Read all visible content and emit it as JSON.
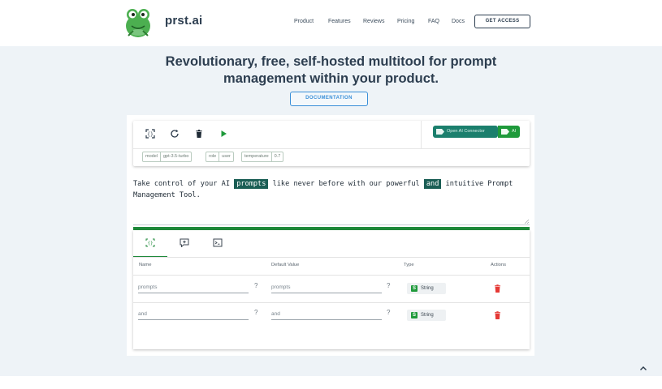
{
  "brand": {
    "name": "prst.ai"
  },
  "nav": {
    "items": [
      "Product",
      "Features",
      "Reviews",
      "Pricing",
      "FAQ",
      "Docs"
    ],
    "cta": "GET ACCESS"
  },
  "hero": {
    "title_line1": "Revolutionary, free, self-hosted multitool for prompt",
    "title_line2": "management within your product.",
    "doc_button": "DOCUMENTATION"
  },
  "toolbar": {
    "icons": [
      "fullscreen-icon",
      "refresh-icon",
      "trash-icon",
      "play-icon"
    ],
    "connector_label": "Open AI Connector",
    "ai_label": "AI",
    "chips": [
      {
        "key": "model",
        "value": "gpt-3.5-turbo"
      },
      {
        "key": "role",
        "value": "user"
      },
      {
        "key": "temperature",
        "value": "0.7"
      }
    ]
  },
  "prompt": {
    "part1": "Take control of your AI ",
    "hl1": "prompts",
    "part2": " like never before with our powerful ",
    "hl2": "and",
    "part3": " intuitive Prompt",
    "line2": "Management Tool."
  },
  "variables": {
    "tabs": [
      "variables-tab",
      "chat-tab",
      "console-tab"
    ],
    "headers": {
      "name": "Name",
      "default": "Default Value",
      "type": "Type",
      "actions": "Actions"
    },
    "rows": [
      {
        "name": "prompts",
        "default": "prompts",
        "type_badge": "S",
        "type": "String"
      },
      {
        "name": "and",
        "default": "and",
        "type_badge": "S",
        "type": "String"
      }
    ],
    "help": "?"
  },
  "colors": {
    "primary_dark": "#2d3e50",
    "accent_green": "#1f8a3b",
    "connector_teal": "#1b7f6d",
    "highlight": "#1b5e55",
    "doc_blue": "#3a8fd8",
    "danger": "#e53935",
    "hero_bg": "#eef3f7"
  }
}
